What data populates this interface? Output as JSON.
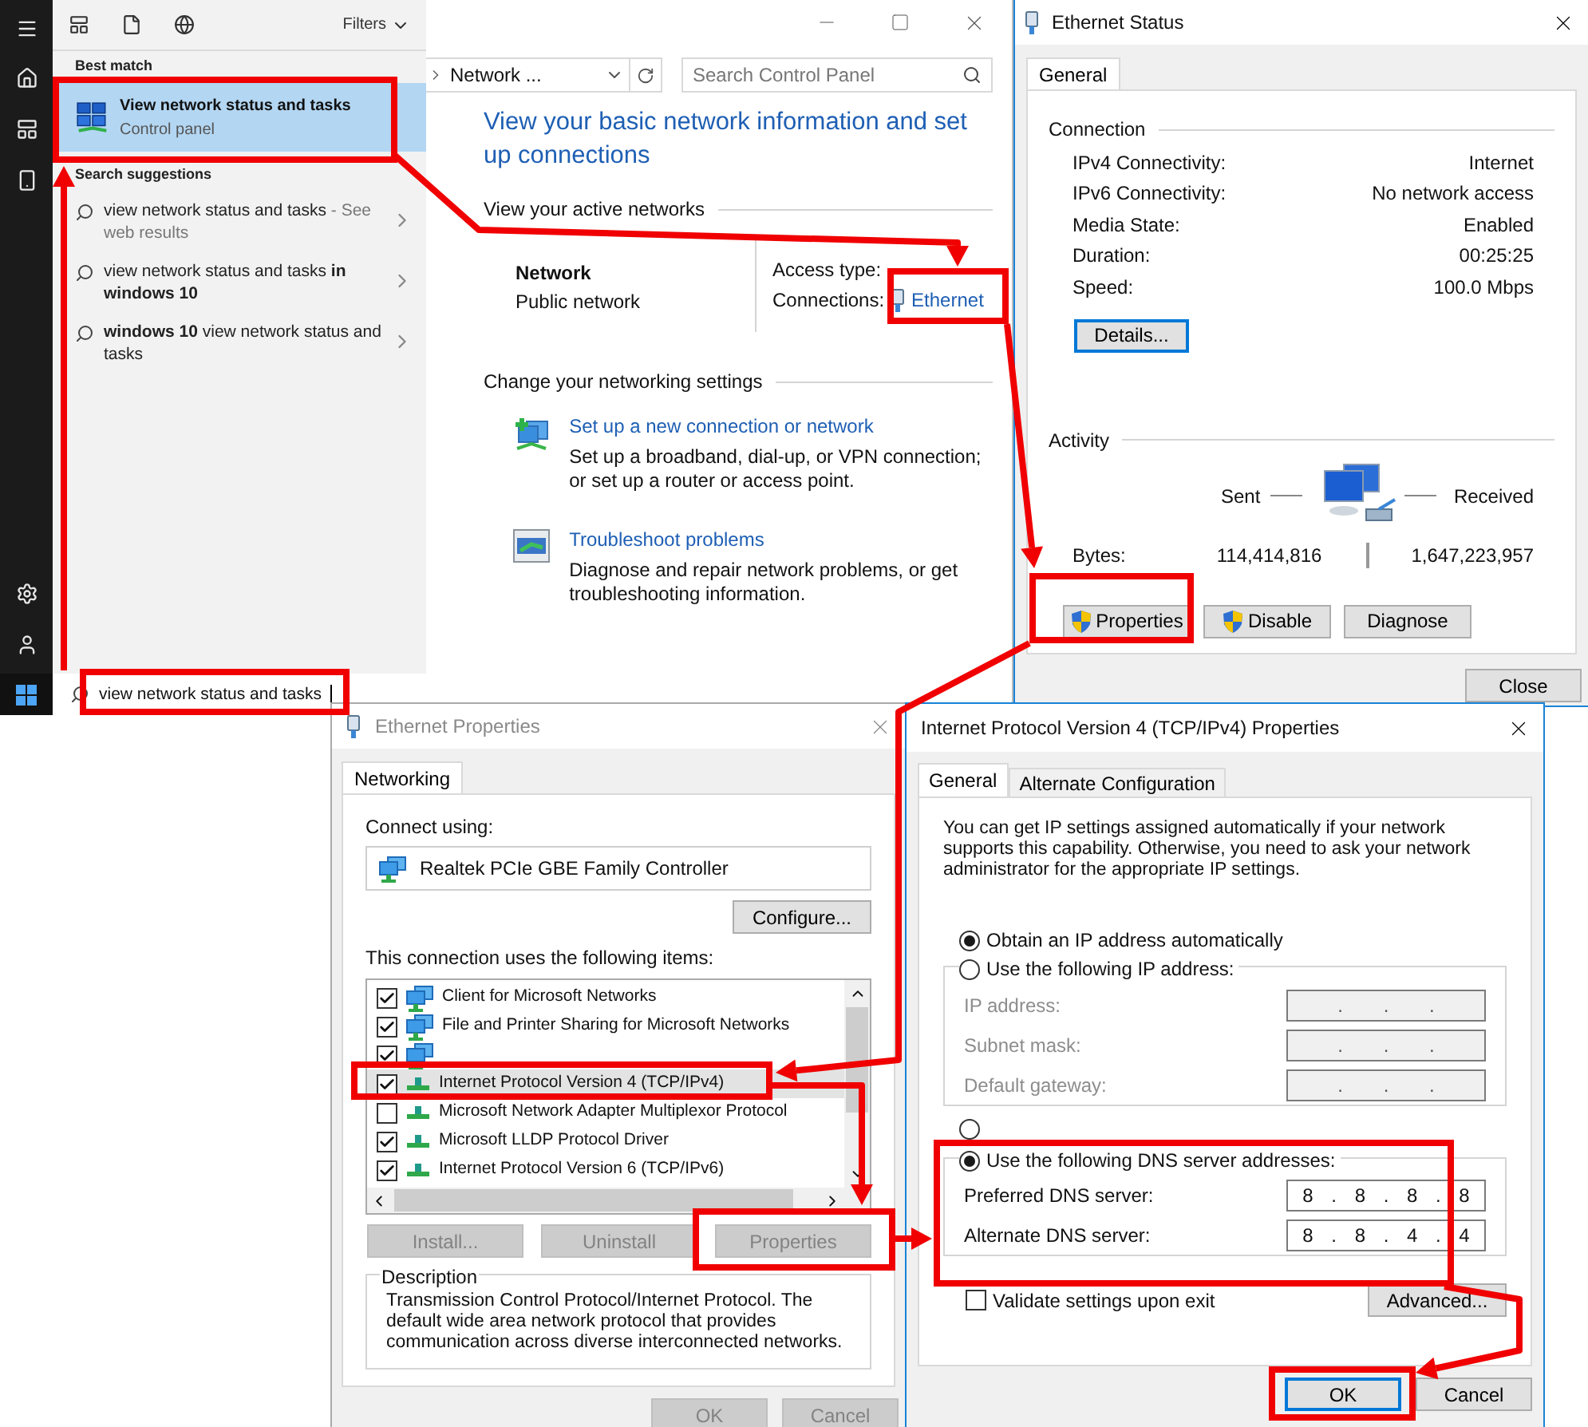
{
  "start_menu": {
    "filters": "Filters",
    "best_match_heading": "Best match",
    "best_match": {
      "title": "View network status and tasks",
      "subtitle": "Control panel",
      "selected": true
    },
    "suggestions_heading": "Search suggestions",
    "suggestions": [
      {
        "text": "view network status and tasks",
        "hint": " - See web results"
      },
      {
        "text": "view network status and tasks **in windows 10**"
      },
      {
        "text": "**windows 10** view network status and tasks"
      }
    ],
    "search_value": "view network status and tasks"
  },
  "control_panel": {
    "breadcrumb": "Network ...",
    "search_placeholder": "Search Control Panel",
    "heading": "View your basic network information and set up connections",
    "active_networks_heading": "View your active networks",
    "network_name": "Network",
    "network_category": "Public network",
    "access_type_label": "Access type:",
    "connections_label": "Connections:",
    "connection_link": "Ethernet",
    "settings_heading": "Change your networking settings",
    "tasks": [
      {
        "kind": "setup",
        "title": "Set up a new connection or network",
        "description": "Set up a broadband, dial-up, or VPN connection; or set up a router or access point."
      },
      {
        "kind": "troubleshoot",
        "title": "Troubleshoot problems",
        "description": "Diagnose and repair network problems, or get troubleshooting information."
      }
    ]
  },
  "ethernet_status": {
    "title": "Ethernet Status",
    "tabs": [
      {
        "label": "General",
        "selected": true
      }
    ],
    "connection_heading": "Connection",
    "rows": [
      {
        "label": "IPv4 Connectivity:",
        "value": "Internet"
      },
      {
        "label": "IPv6 Connectivity:",
        "value": "No network access"
      },
      {
        "label": "Media State:",
        "value": "Enabled"
      },
      {
        "label": "Duration:",
        "value": "00:25:25"
      },
      {
        "label": "Speed:",
        "value": "100.0 Mbps"
      }
    ],
    "details": {
      "label": "Details...",
      "focused": true
    },
    "activity_heading": "Activity",
    "sent_label": "Sent",
    "received_label": "Received",
    "bytes_label": "Bytes:",
    "bytes_sent": "114,414,816",
    "bytes_received": "1,647,223,957",
    "buttons": [
      {
        "label": "Properties",
        "shield": true
      },
      {
        "label": "Disable",
        "shield": true
      },
      {
        "label": "Diagnose",
        "shield": false
      }
    ],
    "close": "Close"
  },
  "ethernet_properties": {
    "title": "Ethernet Properties",
    "tabs": [
      {
        "label": "Networking",
        "selected": true
      }
    ],
    "connect_using_label": "Connect using:",
    "adapter": "Realtek PCIe GBE Family Controller",
    "configure": "Configure...",
    "items_label": "This connection uses the following items:",
    "items": [
      {
        "kind": "client",
        "label": "Client for Microsoft Networks",
        "checked": true,
        "selected": false
      },
      {
        "kind": "client",
        "label": "File and Printer Sharing for Microsoft Networks",
        "checked": true,
        "selected": false
      },
      {
        "kind": "client",
        "checked": true,
        "selected": false
      },
      {
        "kind": "protocol",
        "label": "Internet Protocol Version 4 (TCP/IPv4)",
        "checked": true,
        "selected": true
      },
      {
        "kind": "protocol",
        "label": "Microsoft Network Adapter Multiplexor Protocol",
        "checked": false,
        "selected": false
      },
      {
        "kind": "protocol",
        "label": "Microsoft LLDP Protocol Driver",
        "checked": true,
        "selected": false
      },
      {
        "kind": "protocol",
        "label": "Internet Protocol Version 6 (TCP/IPv6)",
        "checked": true,
        "selected": false
      }
    ],
    "item_buttons": [
      {
        "label": "Install...",
        "disabled": true
      },
      {
        "label": "Uninstall",
        "disabled": true
      },
      {
        "label": "Properties",
        "disabled": true
      }
    ],
    "description_heading": "Description",
    "description": "Transmission Control Protocol/Internet Protocol. The default wide area network protocol that provides communication across diverse interconnected networks.",
    "buttons": [
      {
        "label": "OK",
        "disabled": true
      },
      {
        "label": "Cancel",
        "disabled": true
      }
    ]
  },
  "ipv4_properties": {
    "title": "Internet Protocol Version 4 (TCP/IPv4) Properties",
    "tabs": [
      {
        "label": "General",
        "selected": true
      },
      {
        "label": "Alternate Configuration",
        "selected": false
      }
    ],
    "intro": "You can get IP settings assigned automatically if your network supports this capability. Otherwise, you need to ask your network administrator for the appropriate IP settings.",
    "ip_options": [
      {
        "label": "Obtain an IP address automatically",
        "selected": true
      },
      {
        "label": "Use the following IP address:",
        "selected": false
      }
    ],
    "ip_fields": [
      {
        "label": "IP address:",
        "value": ". . .",
        "disabled": true
      },
      {
        "label": "Subnet mask:",
        "value": ". . .",
        "disabled": true
      },
      {
        "label": "Default gateway:",
        "value": ". . .",
        "disabled": true
      }
    ],
    "dns_options": [
      {
        "selected": false
      },
      {
        "label": "Use the following DNS server addresses:",
        "selected": true
      }
    ],
    "dns_fields": [
      {
        "label": "Preferred DNS server:",
        "value": "8 . 8 . 8 . 8",
        "disabled": false
      },
      {
        "label": "Alternate DNS server:",
        "value": "8 . 8 . 4 . 4",
        "disabled": false
      }
    ],
    "validate": {
      "label": "Validate settings upon exit",
      "checked": false
    },
    "advanced": "Advanced...",
    "buttons": [
      {
        "label": "OK",
        "focused": true
      },
      {
        "label": "Cancel",
        "focused": false
      }
    ]
  }
}
